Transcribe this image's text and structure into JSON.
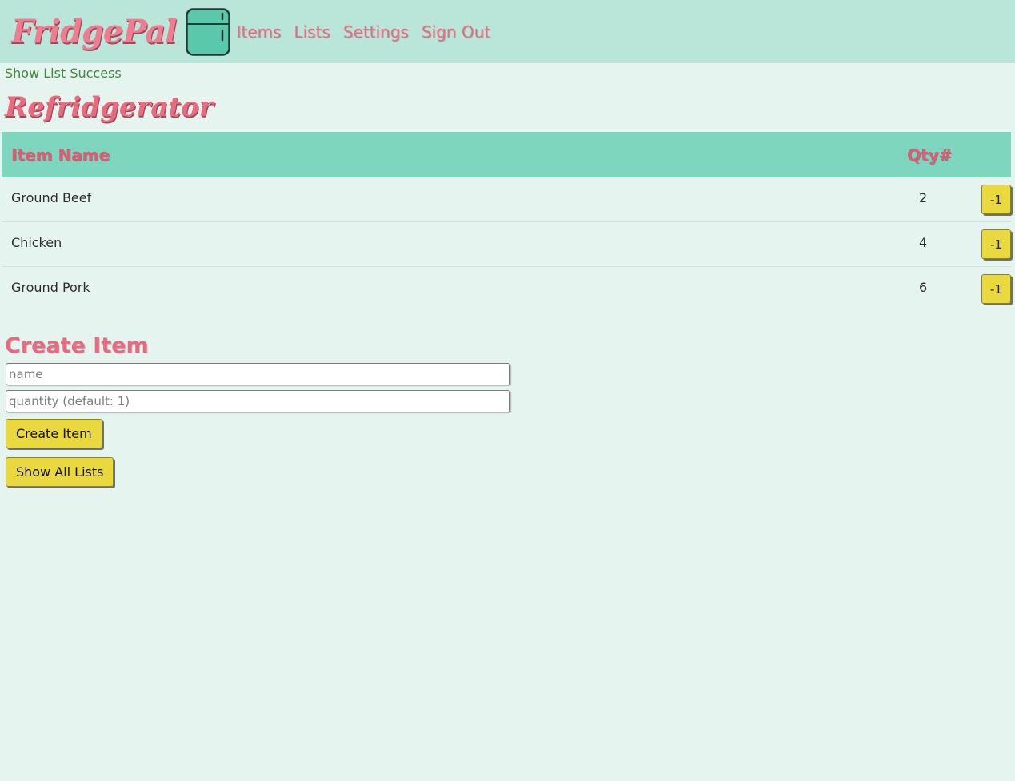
{
  "nav": {
    "brand": "FridgePal",
    "links": [
      {
        "label": "Items"
      },
      {
        "label": "Lists"
      },
      {
        "label": "Settings"
      },
      {
        "label": "Sign Out"
      }
    ]
  },
  "flash": "Show List Success",
  "list": {
    "title": "Refridgerator",
    "columns": [
      "Item Name",
      "Qty#"
    ],
    "items": [
      {
        "name": "Ground Beef",
        "qty": "2",
        "action": "-1"
      },
      {
        "name": "Chicken",
        "qty": "4",
        "action": "-1"
      },
      {
        "name": "Ground Pork",
        "qty": "6",
        "action": "-1"
      }
    ]
  },
  "create": {
    "title": "Create Item",
    "name_placeholder": "name",
    "qty_placeholder": "quantity (default: 1)",
    "submit_label": "Create Item",
    "show_all_label": "Show All Lists"
  },
  "colors": {
    "navbar_bg": "#bae6da",
    "page_bg": "#e6f4f0",
    "accent_pink": "#e96c82",
    "table_header_bg": "#7fd6bf",
    "button_yellow": "#ead83f",
    "success_green": "#3f8a3d",
    "fridge_teal": "#5ac8ab"
  },
  "icons": {
    "logo": "fridge-icon"
  }
}
